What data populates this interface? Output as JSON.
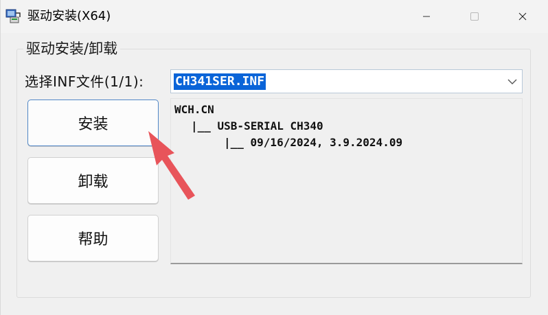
{
  "window": {
    "title": "驱动安装(X64)"
  },
  "group": {
    "title": "驱动安装/卸载"
  },
  "inf": {
    "label": "选择INF文件(1/1):",
    "selected": "CH341SER.INF"
  },
  "buttons": {
    "install": "安装",
    "uninstall": "卸载",
    "help": "帮助"
  },
  "info": {
    "lines": [
      "WCH.CN",
      "|__ USB-SERIAL CH340",
      "|__ 09/16/2024, 3.9.2024.09"
    ]
  },
  "colors": {
    "selection": "#0a64d8",
    "focus_border": "#4f86c6",
    "annotation_arrow": "#e8545a"
  },
  "icons": [
    "app-icon",
    "minimize-icon",
    "maximize-icon",
    "close-icon",
    "chevron-down-icon"
  ]
}
